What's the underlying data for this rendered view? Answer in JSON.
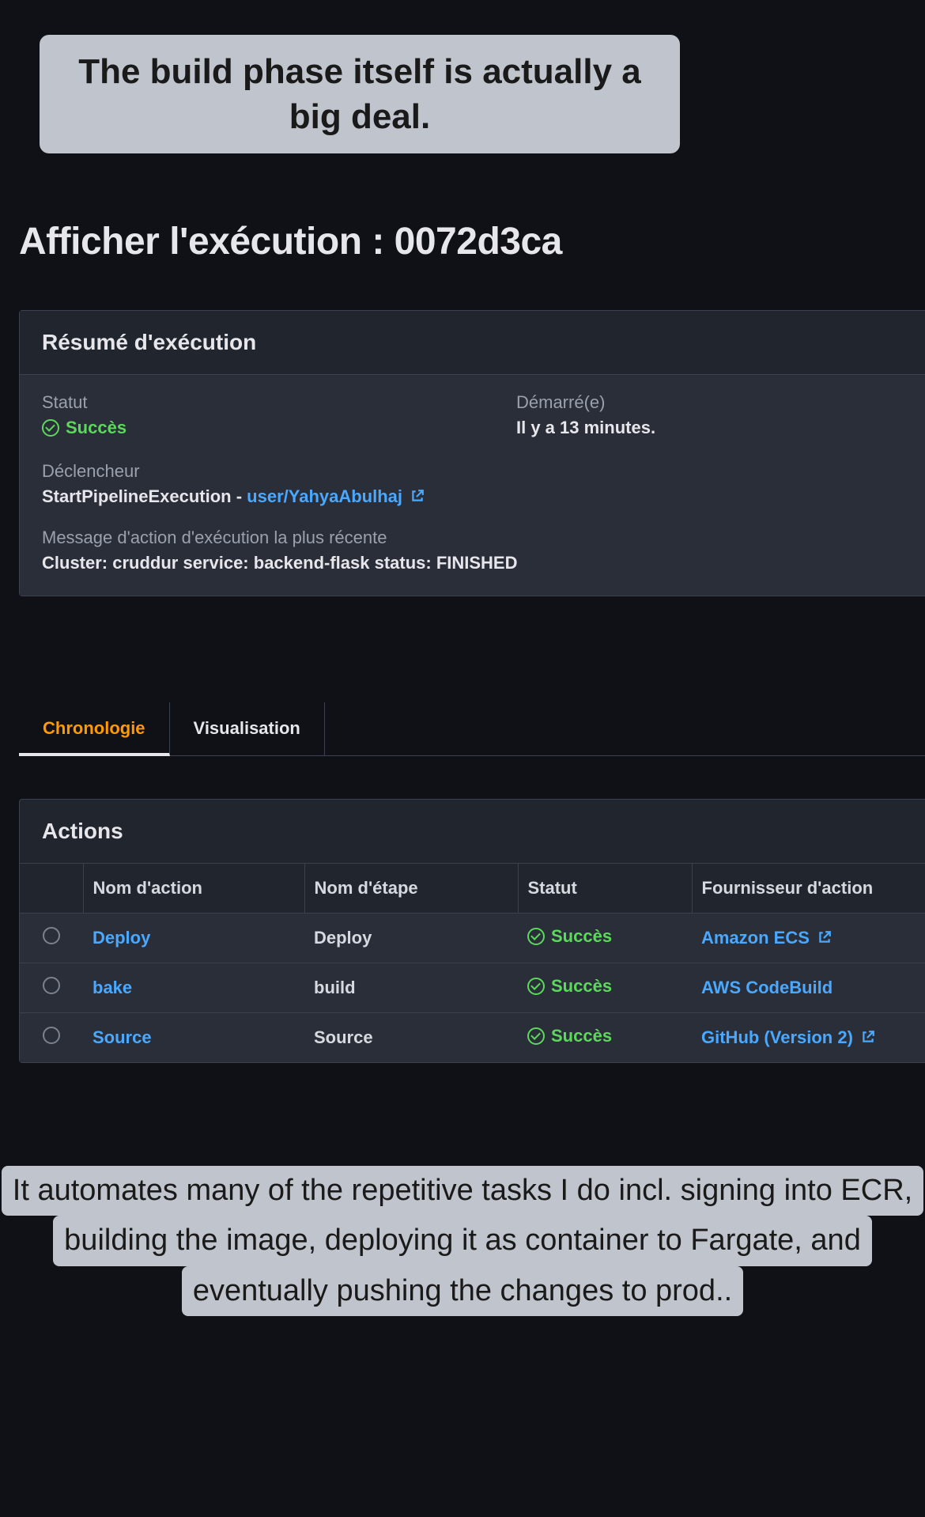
{
  "captions": {
    "top": "The build phase itself is actually a big deal.",
    "bottom_line1": "It automates many of the repetitive tasks I do incl. signing into ECR,",
    "bottom_line2": "building the image, deploying it as container to Fargate, and",
    "bottom_line3": "eventually pushing the changes to prod.."
  },
  "page_title": "Afficher l'exécution : 0072d3ca",
  "summary": {
    "header": "Résumé d'exécution",
    "status_label": "Statut",
    "status_value": "Succès",
    "started_label": "Démarré(e)",
    "started_value": "Il y a 13 minutes.",
    "trigger_label": "Déclencheur",
    "trigger_prefix": "StartPipelineExecution - ",
    "trigger_user": "user/YahyaAbulhaj",
    "recent_msg_label": "Message d'action d'exécution la plus récente",
    "recent_msg_value": "Cluster: cruddur service: backend-flask status: FINISHED"
  },
  "tabs": {
    "chronologie": "Chronologie",
    "visualisation": "Visualisation"
  },
  "actions": {
    "header": "Actions",
    "cols": {
      "name": "Nom d'action",
      "stage": "Nom d'étape",
      "status": "Statut",
      "provider": "Fournisseur d'action"
    },
    "rows": [
      {
        "name": "Deploy",
        "stage": "Deploy",
        "status": "Succès",
        "provider": "Amazon ECS",
        "provider_ext": true
      },
      {
        "name": "bake",
        "stage": "build",
        "status": "Succès",
        "provider": "AWS CodeBuild",
        "provider_ext": false
      },
      {
        "name": "Source",
        "stage": "Source",
        "status": "Succès",
        "provider": "GitHub (Version 2)",
        "provider_ext": true
      }
    ]
  }
}
